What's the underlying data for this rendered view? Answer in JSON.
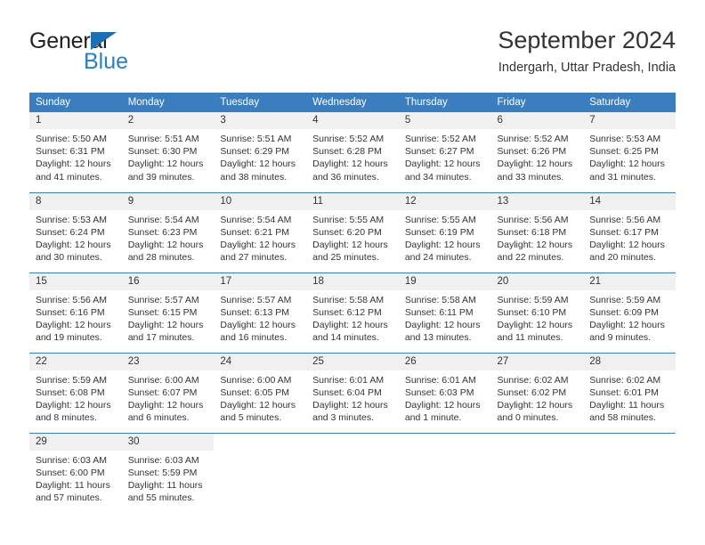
{
  "logo": {
    "word_one": "General",
    "word_two": "Blue",
    "triangle_color": "#1c6fb5",
    "blue_color": "#2980c4"
  },
  "header": {
    "title": "September 2024",
    "subtitle": "Indergarh, Uttar Pradesh, India"
  },
  "theme": {
    "header_bg": "#3a7ebf",
    "daynum_bg": "#f0f0f0",
    "text": "#333333"
  },
  "calendar": {
    "weekday_headers": [
      "Sunday",
      "Monday",
      "Tuesday",
      "Wednesday",
      "Thursday",
      "Friday",
      "Saturday"
    ],
    "weeks": [
      [
        {
          "day": "1",
          "sunrise": "Sunrise: 5:50 AM",
          "sunset": "Sunset: 6:31 PM",
          "daylight_line1": "Daylight: 12 hours",
          "daylight_line2": "and 41 minutes."
        },
        {
          "day": "2",
          "sunrise": "Sunrise: 5:51 AM",
          "sunset": "Sunset: 6:30 PM",
          "daylight_line1": "Daylight: 12 hours",
          "daylight_line2": "and 39 minutes."
        },
        {
          "day": "3",
          "sunrise": "Sunrise: 5:51 AM",
          "sunset": "Sunset: 6:29 PM",
          "daylight_line1": "Daylight: 12 hours",
          "daylight_line2": "and 38 minutes."
        },
        {
          "day": "4",
          "sunrise": "Sunrise: 5:52 AM",
          "sunset": "Sunset: 6:28 PM",
          "daylight_line1": "Daylight: 12 hours",
          "daylight_line2": "and 36 minutes."
        },
        {
          "day": "5",
          "sunrise": "Sunrise: 5:52 AM",
          "sunset": "Sunset: 6:27 PM",
          "daylight_line1": "Daylight: 12 hours",
          "daylight_line2": "and 34 minutes."
        },
        {
          "day": "6",
          "sunrise": "Sunrise: 5:52 AM",
          "sunset": "Sunset: 6:26 PM",
          "daylight_line1": "Daylight: 12 hours",
          "daylight_line2": "and 33 minutes."
        },
        {
          "day": "7",
          "sunrise": "Sunrise: 5:53 AM",
          "sunset": "Sunset: 6:25 PM",
          "daylight_line1": "Daylight: 12 hours",
          "daylight_line2": "and 31 minutes."
        }
      ],
      [
        {
          "day": "8",
          "sunrise": "Sunrise: 5:53 AM",
          "sunset": "Sunset: 6:24 PM",
          "daylight_line1": "Daylight: 12 hours",
          "daylight_line2": "and 30 minutes."
        },
        {
          "day": "9",
          "sunrise": "Sunrise: 5:54 AM",
          "sunset": "Sunset: 6:23 PM",
          "daylight_line1": "Daylight: 12 hours",
          "daylight_line2": "and 28 minutes."
        },
        {
          "day": "10",
          "sunrise": "Sunrise: 5:54 AM",
          "sunset": "Sunset: 6:21 PM",
          "daylight_line1": "Daylight: 12 hours",
          "daylight_line2": "and 27 minutes."
        },
        {
          "day": "11",
          "sunrise": "Sunrise: 5:55 AM",
          "sunset": "Sunset: 6:20 PM",
          "daylight_line1": "Daylight: 12 hours",
          "daylight_line2": "and 25 minutes."
        },
        {
          "day": "12",
          "sunrise": "Sunrise: 5:55 AM",
          "sunset": "Sunset: 6:19 PM",
          "daylight_line1": "Daylight: 12 hours",
          "daylight_line2": "and 24 minutes."
        },
        {
          "day": "13",
          "sunrise": "Sunrise: 5:56 AM",
          "sunset": "Sunset: 6:18 PM",
          "daylight_line1": "Daylight: 12 hours",
          "daylight_line2": "and 22 minutes."
        },
        {
          "day": "14",
          "sunrise": "Sunrise: 5:56 AM",
          "sunset": "Sunset: 6:17 PM",
          "daylight_line1": "Daylight: 12 hours",
          "daylight_line2": "and 20 minutes."
        }
      ],
      [
        {
          "day": "15",
          "sunrise": "Sunrise: 5:56 AM",
          "sunset": "Sunset: 6:16 PM",
          "daylight_line1": "Daylight: 12 hours",
          "daylight_line2": "and 19 minutes."
        },
        {
          "day": "16",
          "sunrise": "Sunrise: 5:57 AM",
          "sunset": "Sunset: 6:15 PM",
          "daylight_line1": "Daylight: 12 hours",
          "daylight_line2": "and 17 minutes."
        },
        {
          "day": "17",
          "sunrise": "Sunrise: 5:57 AM",
          "sunset": "Sunset: 6:13 PM",
          "daylight_line1": "Daylight: 12 hours",
          "daylight_line2": "and 16 minutes."
        },
        {
          "day": "18",
          "sunrise": "Sunrise: 5:58 AM",
          "sunset": "Sunset: 6:12 PM",
          "daylight_line1": "Daylight: 12 hours",
          "daylight_line2": "and 14 minutes."
        },
        {
          "day": "19",
          "sunrise": "Sunrise: 5:58 AM",
          "sunset": "Sunset: 6:11 PM",
          "daylight_line1": "Daylight: 12 hours",
          "daylight_line2": "and 13 minutes."
        },
        {
          "day": "20",
          "sunrise": "Sunrise: 5:59 AM",
          "sunset": "Sunset: 6:10 PM",
          "daylight_line1": "Daylight: 12 hours",
          "daylight_line2": "and 11 minutes."
        },
        {
          "day": "21",
          "sunrise": "Sunrise: 5:59 AM",
          "sunset": "Sunset: 6:09 PM",
          "daylight_line1": "Daylight: 12 hours",
          "daylight_line2": "and 9 minutes."
        }
      ],
      [
        {
          "day": "22",
          "sunrise": "Sunrise: 5:59 AM",
          "sunset": "Sunset: 6:08 PM",
          "daylight_line1": "Daylight: 12 hours",
          "daylight_line2": "and 8 minutes."
        },
        {
          "day": "23",
          "sunrise": "Sunrise: 6:00 AM",
          "sunset": "Sunset: 6:07 PM",
          "daylight_line1": "Daylight: 12 hours",
          "daylight_line2": "and 6 minutes."
        },
        {
          "day": "24",
          "sunrise": "Sunrise: 6:00 AM",
          "sunset": "Sunset: 6:05 PM",
          "daylight_line1": "Daylight: 12 hours",
          "daylight_line2": "and 5 minutes."
        },
        {
          "day": "25",
          "sunrise": "Sunrise: 6:01 AM",
          "sunset": "Sunset: 6:04 PM",
          "daylight_line1": "Daylight: 12 hours",
          "daylight_line2": "and 3 minutes."
        },
        {
          "day": "26",
          "sunrise": "Sunrise: 6:01 AM",
          "sunset": "Sunset: 6:03 PM",
          "daylight_line1": "Daylight: 12 hours",
          "daylight_line2": "and 1 minute."
        },
        {
          "day": "27",
          "sunrise": "Sunrise: 6:02 AM",
          "sunset": "Sunset: 6:02 PM",
          "daylight_line1": "Daylight: 12 hours",
          "daylight_line2": "and 0 minutes."
        },
        {
          "day": "28",
          "sunrise": "Sunrise: 6:02 AM",
          "sunset": "Sunset: 6:01 PM",
          "daylight_line1": "Daylight: 11 hours",
          "daylight_line2": "and 58 minutes."
        }
      ],
      [
        {
          "day": "29",
          "sunrise": "Sunrise: 6:03 AM",
          "sunset": "Sunset: 6:00 PM",
          "daylight_line1": "Daylight: 11 hours",
          "daylight_line2": "and 57 minutes."
        },
        {
          "day": "30",
          "sunrise": "Sunrise: 6:03 AM",
          "sunset": "Sunset: 5:59 PM",
          "daylight_line1": "Daylight: 11 hours",
          "daylight_line2": "and 55 minutes."
        },
        {
          "day": "",
          "sunrise": "",
          "sunset": "",
          "daylight_line1": "",
          "daylight_line2": ""
        },
        {
          "day": "",
          "sunrise": "",
          "sunset": "",
          "daylight_line1": "",
          "daylight_line2": ""
        },
        {
          "day": "",
          "sunrise": "",
          "sunset": "",
          "daylight_line1": "",
          "daylight_line2": ""
        },
        {
          "day": "",
          "sunrise": "",
          "sunset": "",
          "daylight_line1": "",
          "daylight_line2": ""
        },
        {
          "day": "",
          "sunrise": "",
          "sunset": "",
          "daylight_line1": "",
          "daylight_line2": ""
        }
      ]
    ]
  }
}
